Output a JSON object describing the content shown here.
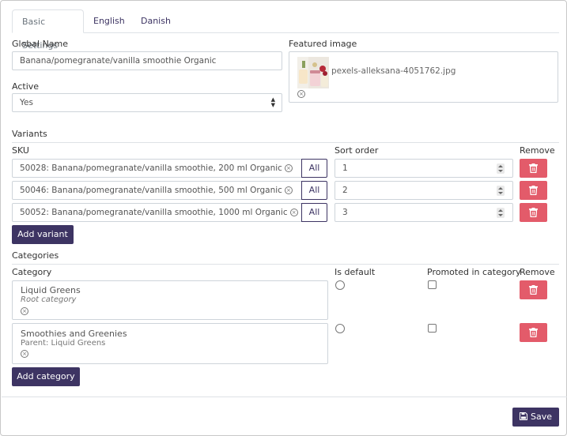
{
  "tabs": [
    {
      "label": "Basic Settings",
      "active": true
    },
    {
      "label": "English",
      "active": false
    },
    {
      "label": "Danish",
      "active": false
    }
  ],
  "global_name": {
    "label": "Global Name",
    "value": "Banana/pomegranate/vanilla smoothie Organic"
  },
  "active": {
    "label": "Active",
    "value": "Yes"
  },
  "featured_image": {
    "label": "Featured image",
    "filename": "pexels-alleksana-4051762.jpg"
  },
  "variants": {
    "title": "Variants",
    "sku_header": "SKU",
    "sort_header": "Sort order",
    "remove_header": "Remove",
    "all_label": "All",
    "rows": [
      {
        "sku": "50028: Banana/pomegranate/vanilla smoothie, 200 ml Organic",
        "sort": "1"
      },
      {
        "sku": "50046: Banana/pomegranate/vanilla smoothie, 500 ml Organic",
        "sort": "2"
      },
      {
        "sku": "50052: Banana/pomegranate/vanilla smoothie, 1000 ml Organic",
        "sort": "3"
      }
    ],
    "add_label": "Add variant"
  },
  "categories": {
    "title": "Categories",
    "category_header": "Category",
    "default_header": "Is default",
    "promoted_header": "Promoted in category",
    "remove_header": "Remove",
    "rows": [
      {
        "name": "Liquid Greens",
        "sub": "Root category"
      },
      {
        "name": "Smoothies and Greenies",
        "sub": "Parent: Liquid Greens"
      }
    ],
    "add_label": "Add category"
  },
  "save_label": "Save",
  "colors": {
    "primary": "#3d3463",
    "danger": "#e35b6a"
  }
}
